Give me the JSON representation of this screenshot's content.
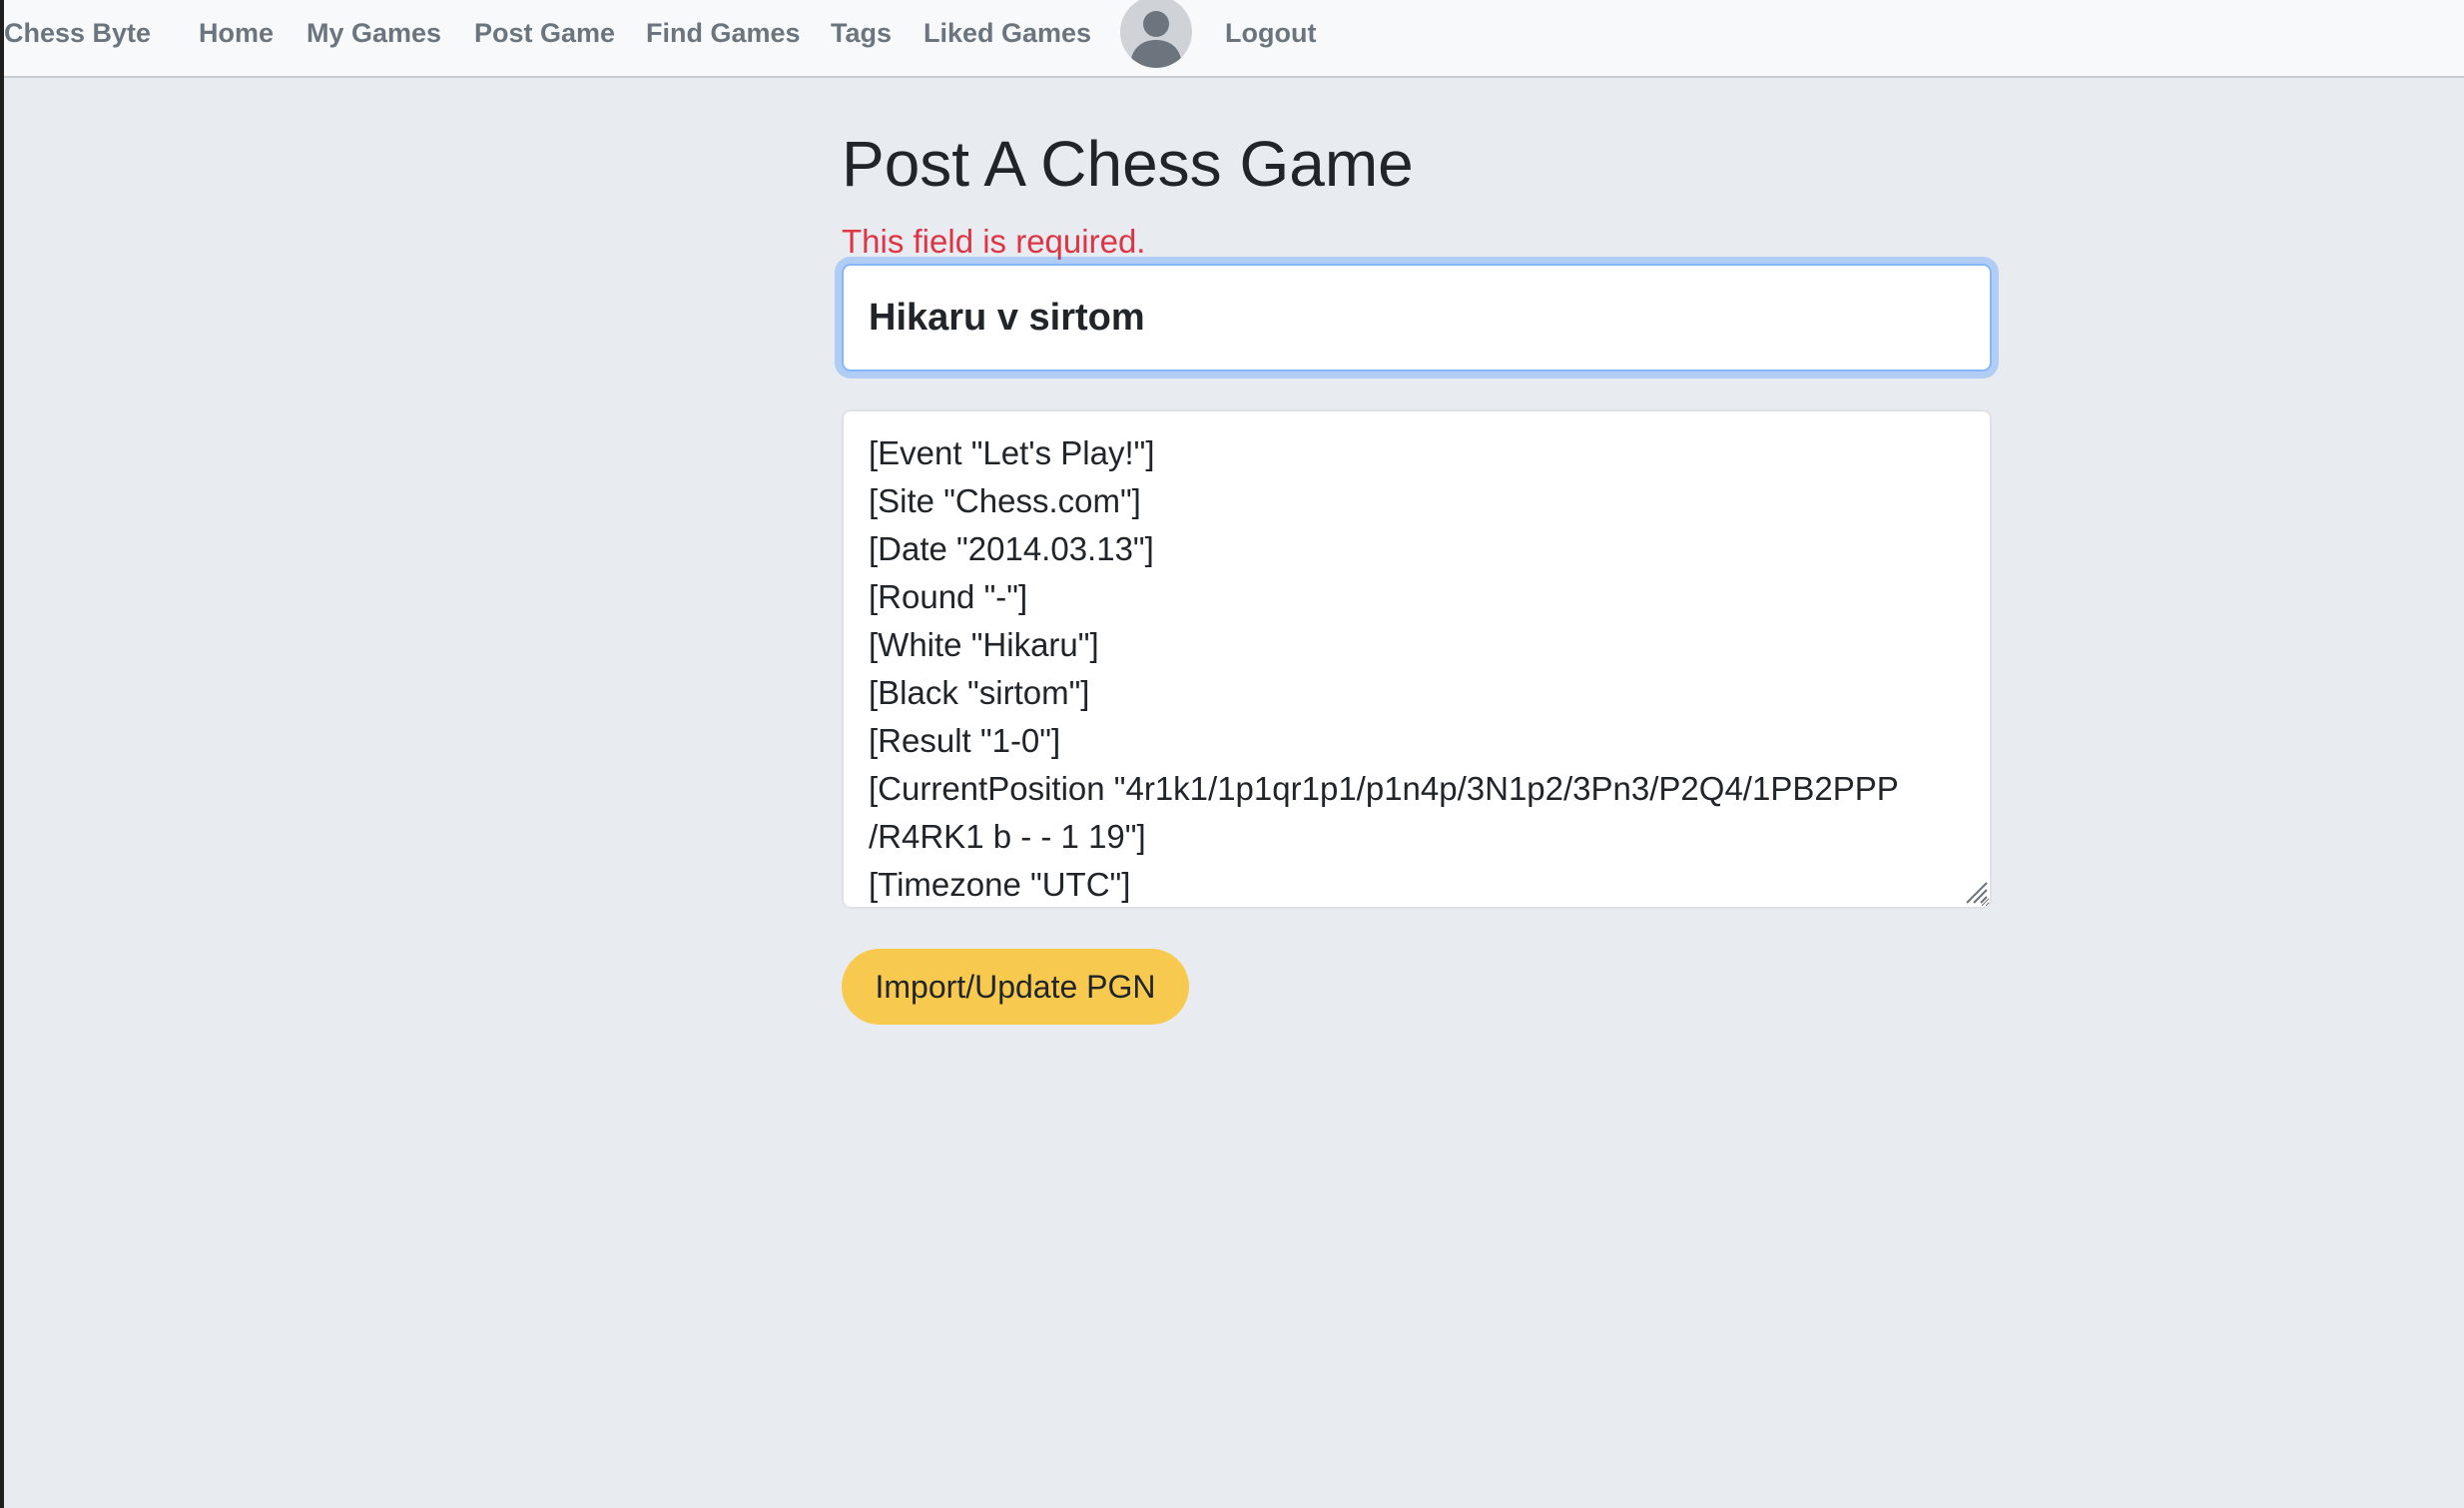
{
  "nav": {
    "brand": "Chess Byte",
    "home": "Home",
    "my_games": "My Games",
    "post_game": "Post Game",
    "find_games": "Find Games",
    "tags": "Tags",
    "liked_games": "Liked Games",
    "logout": "Logout",
    "avatar_icon": "user-avatar-icon"
  },
  "form": {
    "title": "Post A Chess Game",
    "error": "This field is required.",
    "game_title_value": "Hikaru v sirtom",
    "pgn_value": "[Event \"Let's Play!\"]\n[Site \"Chess.com\"]\n[Date \"2014.03.13\"]\n[Round \"-\"]\n[White \"Hikaru\"]\n[Black \"sirtom\"]\n[Result \"1-0\"]\n[CurrentPosition \"4r1k1/1p1qr1p1/p1n4p/3N1p2/3Pn3/P2Q4/1PB2PPP\n/R4RK1 b - - 1 19\"]\n[Timezone \"UTC\"]",
    "import_button": "Import/Update PGN"
  },
  "colors": {
    "page_bg": "#e8ecf0",
    "navbar_bg": "#f8f9fa",
    "nav_text": "#6c757d",
    "error": "#dc3545",
    "focus_border": "#86b7fe",
    "button_bg": "#f7c94f"
  }
}
